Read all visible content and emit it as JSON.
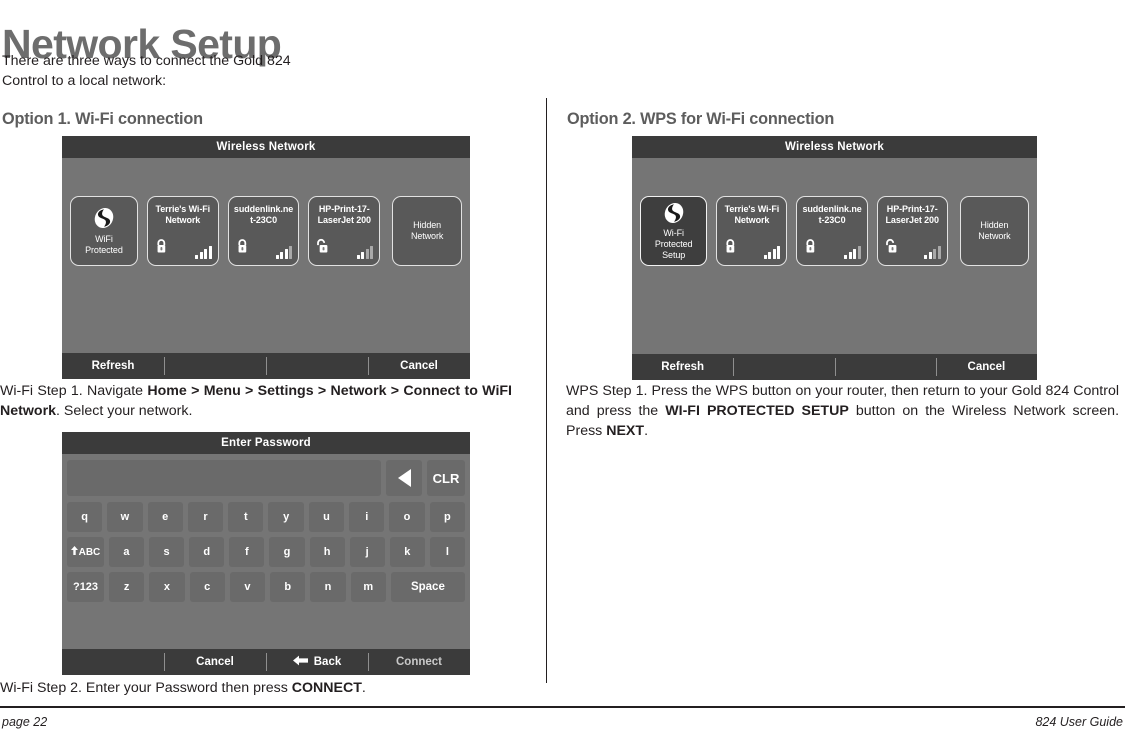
{
  "document": {
    "title": "Network Setup",
    "intro_line1": "There are three ways to connect the Gold 824",
    "intro_line2": "Control to a local network:",
    "footer_left": "page 22",
    "footer_right": "824 User Guide"
  },
  "option1": {
    "heading": "Option 1.  Wi-Fi connection",
    "screen1": {
      "title": "Wireless Network",
      "tiles": [
        {
          "name": "wps-tile",
          "label_lines": [
            "WiFi",
            "Protected"
          ],
          "icon": "wps-icon",
          "selected": false,
          "lock": "none",
          "signal": 0
        },
        {
          "name": "network-tile-terries",
          "label_lines": [
            "Terrie's Wi-Fi",
            "Network"
          ],
          "icon": "none",
          "selected": false,
          "lock": "locked",
          "signal": 4
        },
        {
          "name": "network-tile-suddenlink",
          "label_lines": [
            "suddenlink.ne",
            "t-23C0"
          ],
          "icon": "none",
          "selected": false,
          "lock": "locked",
          "signal": 3
        },
        {
          "name": "network-tile-hp-print",
          "label_lines": [
            "HP-Print-17-",
            "LaserJet 200"
          ],
          "icon": "none",
          "selected": false,
          "lock": "unlocked",
          "signal": 2
        },
        {
          "name": "network-tile-hidden",
          "label_lines": [
            "Hidden",
            "Network"
          ],
          "icon": "none",
          "selected": false,
          "lock": "none",
          "signal": 0
        }
      ],
      "actions": [
        "Refresh",
        "",
        "",
        "Cancel"
      ]
    },
    "caption1_a": "Wi-Fi Step 1. Navigate  ",
    "caption1_b": "Home > Menu > Settings > Network > Connect to WiFI Network",
    "caption1_c": ".  Select your network.",
    "screen2": {
      "title": "Enter Password",
      "password_value": "",
      "backspace_label": "backspace-arrow",
      "clear_label": "CLR",
      "row1": [
        "q",
        "w",
        "e",
        "r",
        "t",
        "y",
        "u",
        "i",
        "o",
        "p"
      ],
      "row2_mod": "ABC",
      "row2": [
        "a",
        "s",
        "d",
        "f",
        "g",
        "h",
        "j",
        "k",
        "l"
      ],
      "row3_mod": "?123",
      "row3": [
        "z",
        "x",
        "c",
        "v",
        "b",
        "n",
        "m"
      ],
      "space_label": "Space",
      "actions": [
        "",
        "Cancel",
        "Back",
        "Connect"
      ]
    },
    "caption2_a": "Wi-Fi Step 2. Enter your Password then press ",
    "caption2_b": "CONNECT",
    "caption2_c": "."
  },
  "option2": {
    "heading": "Option 2.  WPS for Wi-Fi connection",
    "screen": {
      "title": "Wireless Network",
      "tiles": [
        {
          "name": "wps-tile",
          "label_lines": [
            "Wi-Fi",
            "Protected",
            "Setup"
          ],
          "icon": "wps-icon",
          "selected": true,
          "lock": "none",
          "signal": 0
        },
        {
          "name": "network-tile-terries",
          "label_lines": [
            "Terrie's Wi-Fi",
            "Network"
          ],
          "icon": "none",
          "selected": false,
          "lock": "locked",
          "signal": 4
        },
        {
          "name": "network-tile-suddenlink",
          "label_lines": [
            "suddenlink.ne",
            "t-23C0"
          ],
          "icon": "none",
          "selected": false,
          "lock": "locked",
          "signal": 3
        },
        {
          "name": "network-tile-hp-print",
          "label_lines": [
            "HP-Print-17-",
            "LaserJet 200"
          ],
          "icon": "none",
          "selected": false,
          "lock": "unlocked",
          "signal": 2
        },
        {
          "name": "network-tile-hidden",
          "label_lines": [
            "Hidden",
            "Network"
          ],
          "icon": "none",
          "selected": false,
          "lock": "none",
          "signal": 0
        }
      ],
      "actions": [
        "Refresh",
        "",
        "",
        "Cancel"
      ]
    },
    "caption_a": "WPS Step 1.  Press the WPS button on your router, then return to your Gold 824 Control and press the  ",
    "caption_b": "WI-FI PROTECTED SETUP",
    "caption_c": " button on the Wireless Network screen.  Press ",
    "caption_d": "NEXT",
    "caption_e": "."
  },
  "colors": {
    "screen_body": "#757575",
    "screen_header": "#3b3b3b",
    "tile": "#595959",
    "tile_selected": "#3e3e3e",
    "key": "#6a6a6a",
    "text_dark": "#231f20",
    "heading_gray": "#5d5d5d"
  }
}
